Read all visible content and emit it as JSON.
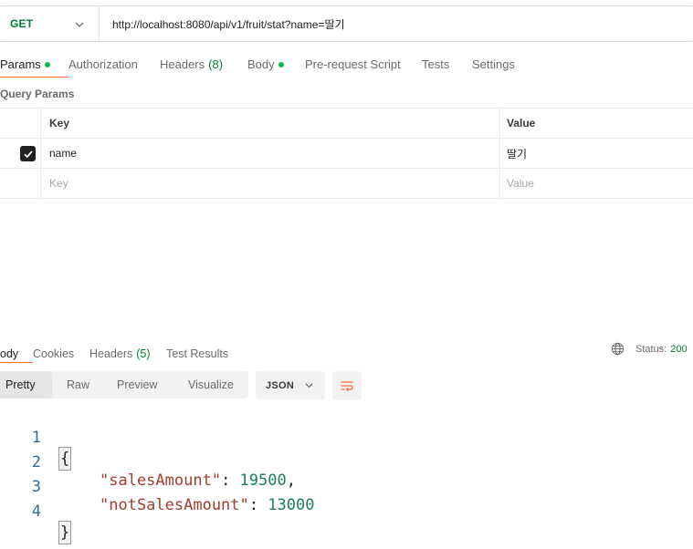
{
  "request": {
    "method": "GET",
    "url": "http://localhost:8080/api/v1/fruit/stat?name=딸기"
  },
  "request_tabs": [
    {
      "label": "Params",
      "dot": true,
      "active": true
    },
    {
      "label": "Authorization"
    },
    {
      "label": "Headers",
      "count": "(8)"
    },
    {
      "label": "Body",
      "dot": true
    },
    {
      "label": "Pre-request Script"
    },
    {
      "label": "Tests"
    },
    {
      "label": "Settings"
    }
  ],
  "query_params": {
    "title": "Query Params",
    "columns": {
      "key": "Key",
      "value": "Value"
    },
    "rows": [
      {
        "checked": true,
        "key": "name",
        "value": "딸기"
      }
    ],
    "placeholder": {
      "key": "Key",
      "value": "Value"
    }
  },
  "response_tabs": [
    {
      "label": "Body",
      "visible": "ody",
      "active": true
    },
    {
      "label": "Cookies"
    },
    {
      "label": "Headers",
      "count": "(5)"
    },
    {
      "label": "Test Results"
    }
  ],
  "response_status": {
    "label": "Status:",
    "code": "200"
  },
  "formats": [
    "Pretty",
    "Raw",
    "Preview",
    "Visualize"
  ],
  "active_format": "Pretty",
  "language": "JSON",
  "body_lines": {
    "l1": "1",
    "l2": "2",
    "l3": "3",
    "l4": "4",
    "open": "{",
    "close": "}",
    "key1": "\"salesAmount\"",
    "val1": "19500",
    "key2": "\"notSalesAmount\"",
    "val2": "13000"
  },
  "colors": {
    "accent": "#ff6c37",
    "get": "#007f31",
    "dot": "#0cbb52"
  }
}
